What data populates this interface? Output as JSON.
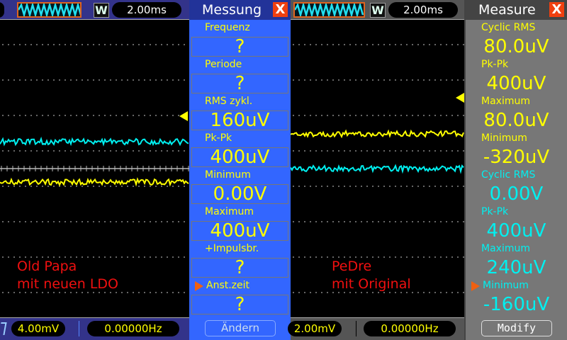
{
  "left": {
    "timebase": "2.00ms",
    "w_label": "W",
    "trigger_level": "4.00mV",
    "frequency": "0.00000Hz",
    "note": [
      "Old Papa",
      "mit neuen LDO"
    ],
    "menu": {
      "title": "Messung",
      "close": "X",
      "button": "Ändern",
      "items": [
        {
          "label": "Frequenz",
          "value": "?"
        },
        {
          "label": "Periode",
          "value": "?"
        },
        {
          "label": "RMS  zykl.",
          "value": "160uV"
        },
        {
          "label": "Pk-Pk",
          "value": "400uV"
        },
        {
          "label": "Minimum",
          "value": "0.00V"
        },
        {
          "label": "Maximum",
          "value": "400uV"
        },
        {
          "label": "+Impulsbr.",
          "value": "?"
        },
        {
          "label": "Anst.zeit",
          "value": "?",
          "selected": true
        }
      ]
    }
  },
  "right": {
    "timebase": "2.00ms",
    "w_label": "W",
    "trigger_level": "2.00mV",
    "frequency": "0.00000Hz",
    "note": [
      "PeDre",
      "mit Original"
    ],
    "menu": {
      "title": "Measure",
      "close": "X",
      "button": "Modify",
      "items": [
        {
          "label": "Cyclic RMS",
          "value": "80.0uV",
          "color": "#ffff00"
        },
        {
          "label": "Pk-Pk",
          "value": "400uV",
          "color": "#ffff00"
        },
        {
          "label": "Maximum",
          "value": "80.0uV",
          "color": "#ffff00"
        },
        {
          "label": "Minimum",
          "value": "-320uV",
          "color": "#ffff00"
        },
        {
          "label": "Cyclic RMS",
          "value": "0.00V",
          "color": "#00f0f0"
        },
        {
          "label": "Pk-Pk",
          "value": "400uV",
          "color": "#00f0f0"
        },
        {
          "label": "Maximum",
          "value": "240uV",
          "color": "#00f0f0"
        },
        {
          "label": "Minimum",
          "value": "-160uV",
          "color": "#00f0f0",
          "selected": true
        }
      ]
    }
  },
  "colors": {
    "ch1": "#ffff00",
    "ch2": "#00f0f0",
    "left_menu": "#3366ff",
    "right_menu": "#777777"
  }
}
